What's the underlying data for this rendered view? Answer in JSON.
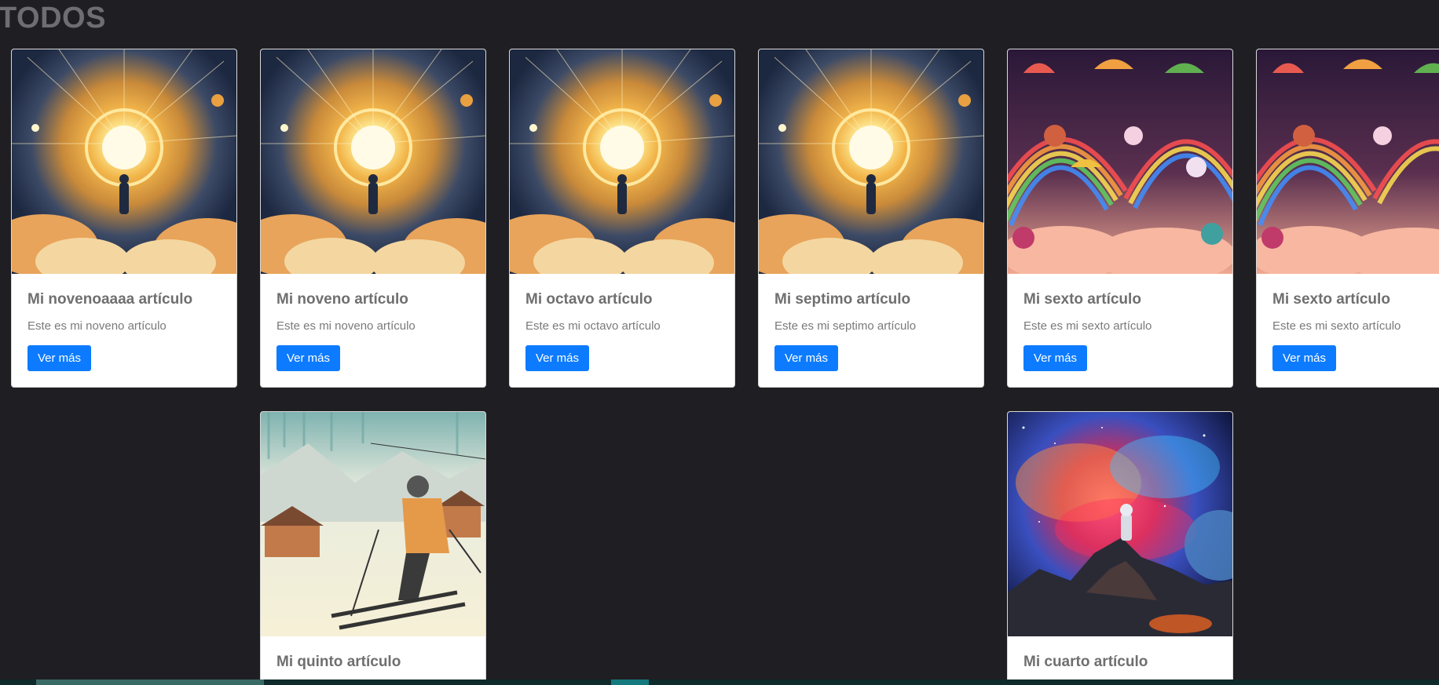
{
  "page": {
    "title": "TODOS"
  },
  "colors": {
    "background": "#1f1f23",
    "button": "#0d7bff",
    "card": "#ffffff"
  },
  "cards": [
    {
      "title": "Mi novenoaaaa artículo",
      "text": "Este es mi noveno artículo",
      "button": "Ver más",
      "image": "portal-light-illustration"
    },
    {
      "title": "Mi noveno artículo",
      "text": "Este es mi noveno artículo",
      "button": "Ver más",
      "image": "portal-light-illustration"
    },
    {
      "title": "Mi octavo artículo",
      "text": "Este es mi octavo artículo",
      "button": "Ver más",
      "image": "portal-light-illustration"
    },
    {
      "title": "Mi septimo artículo",
      "text": "Este es mi septimo artículo",
      "button": "Ver más",
      "image": "portal-light-illustration"
    },
    {
      "title": "Mi sexto artículo",
      "text": "Este es mi sexto artículo",
      "button": "Ver más",
      "image": "rainbow-animals-illustration"
    },
    {
      "title": "Mi sexto artículo",
      "text": "Este es mi sexto artículo",
      "button": "Ver más",
      "image": "rainbow-animals-illustration"
    },
    {
      "title": "Mi quinto artículo",
      "image": "skier-illustration"
    },
    {
      "title": "Mi cuarto artículo",
      "image": "astronaut-nebula-illustration"
    }
  ]
}
